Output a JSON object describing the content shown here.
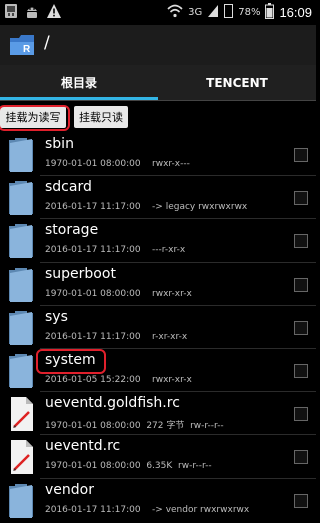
{
  "status_bar": {
    "icons_left": [
      "usb-icon",
      "android-debug-icon",
      "warning-icon"
    ],
    "network": "3G",
    "battery": "78%",
    "time": "16:09"
  },
  "app_bar": {
    "path": "/"
  },
  "tabs": [
    {
      "label": "根目录",
      "active": true
    },
    {
      "label": "TENCENT",
      "active": false
    }
  ],
  "actions": {
    "mount_rw_label": "挂载为读写",
    "mount_ro_label": "挂载只读"
  },
  "files": [
    {
      "name": "sbin",
      "date": "1970-01-01 08:00:00",
      "size": "",
      "perms": "rwxr-x---",
      "type": "folder"
    },
    {
      "name": "sdcard",
      "date": "2016-01-17 11:17:00",
      "size": "",
      "perms": "-> legacy  rwxrwxrwx",
      "type": "folder"
    },
    {
      "name": "storage",
      "date": "2016-01-17 11:17:00",
      "size": "",
      "perms": "---r-xr-x",
      "type": "folder"
    },
    {
      "name": "superboot",
      "date": "1970-01-01 08:00:00",
      "size": "",
      "perms": "rwxr-xr-x",
      "type": "folder"
    },
    {
      "name": "sys",
      "date": "2016-01-17 11:17:00",
      "size": "",
      "perms": "r-xr-xr-x",
      "type": "folder"
    },
    {
      "name": "system",
      "date": "2016-01-05 15:22:00",
      "size": "",
      "perms": "rwxr-xr-x",
      "type": "folder"
    },
    {
      "name": "ueventd.goldfish.rc",
      "date": "1970-01-01 08:00:00",
      "size": "272 字节",
      "perms": "rw-r--r--",
      "type": "file"
    },
    {
      "name": "ueventd.rc",
      "date": "1970-01-01 08:00:00",
      "size": "6.35K",
      "perms": "rw-r--r--",
      "type": "file"
    },
    {
      "name": "vendor",
      "date": "2016-01-17 11:17:00",
      "size": "",
      "perms": "-> vendor  rwxrwxrwx",
      "type": "folder"
    }
  ],
  "colors": {
    "accent": "#33b5e5",
    "highlight": "#e0202c"
  }
}
